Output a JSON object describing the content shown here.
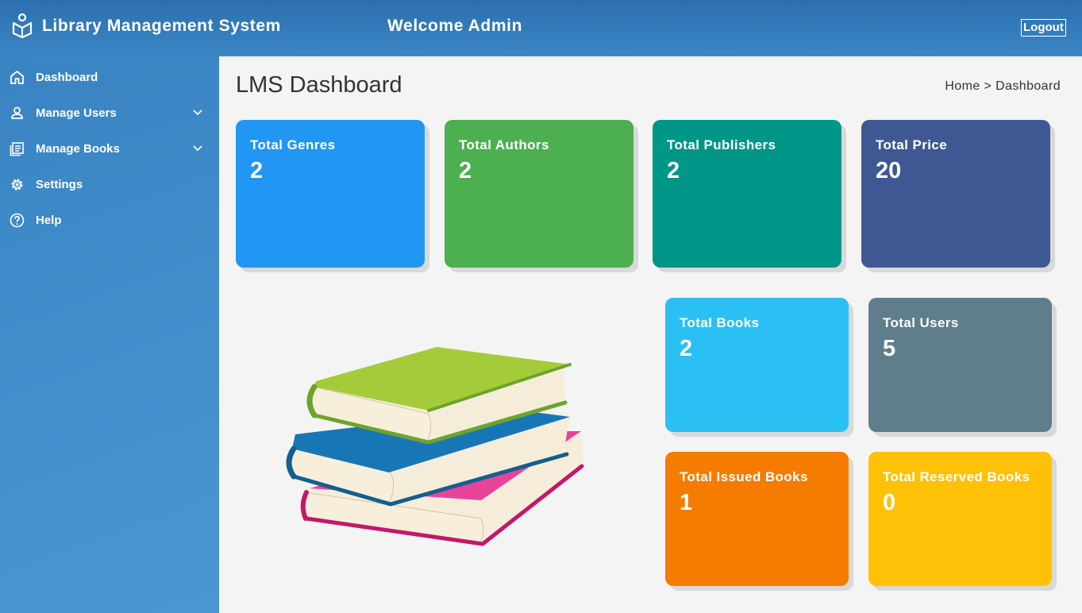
{
  "header": {
    "app_title": "Library Management System",
    "welcome": "Welcome Admin",
    "logout_label": "Logout",
    "logo_icon": "book-reader-icon"
  },
  "sidebar": {
    "items": [
      {
        "label": "Dashboard",
        "icon": "home-icon",
        "has_submenu": false
      },
      {
        "label": "Manage Users",
        "icon": "user-icon",
        "has_submenu": true
      },
      {
        "label": "Manage Books",
        "icon": "books-icon",
        "has_submenu": true
      },
      {
        "label": "Settings",
        "icon": "gear-icon",
        "has_submenu": false
      },
      {
        "label": "Help",
        "icon": "help-icon",
        "has_submenu": false
      }
    ]
  },
  "main": {
    "title": "LMS Dashboard",
    "breadcrumb": "Home > Dashboard",
    "cards": [
      {
        "label": "Total Genres",
        "value": "2",
        "color": "#2196f3"
      },
      {
        "label": "Total Authors",
        "value": "2",
        "color": "#4caf50"
      },
      {
        "label": "Total Publishers",
        "value": "2",
        "color": "#009688"
      },
      {
        "label": "Total Price",
        "value": "20",
        "color": "#3f5894"
      },
      {
        "label": "Total Books",
        "value": "2",
        "color": "#2bc0f4"
      },
      {
        "label": "Total Users",
        "value": "5",
        "color": "#607d8b"
      },
      {
        "label": "Total Issued Books",
        "value": "1",
        "color": "#f57c00"
      },
      {
        "label": "Total Reserved Books",
        "value": "0",
        "color": "#ffc107"
      }
    ],
    "illustration": "stack-of-books-illustration"
  },
  "colors": {
    "header_bg": "#3479b8",
    "sidebar_bg": "#4390cd",
    "page_bg": "#f4f4f4"
  }
}
